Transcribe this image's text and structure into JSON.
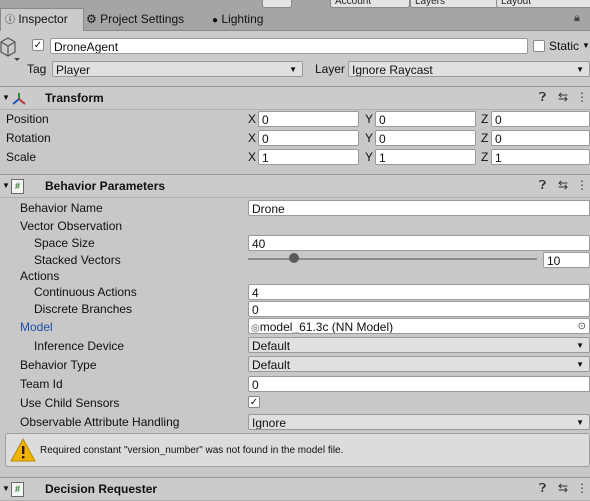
{
  "tabs": [
    {
      "label": "Inspector",
      "icon": "info-icon"
    },
    {
      "label": "Project Settings",
      "icon": "gear-icon"
    },
    {
      "label": "Lighting",
      "icon": "light-bulb-icon"
    }
  ],
  "toolbar": {
    "account": "Account",
    "layers": "Layers",
    "layout": "Layout"
  },
  "object": {
    "name": "DroneAgent",
    "active": true,
    "static_label": "Static",
    "static": false,
    "tag_label": "Tag",
    "tag_value": "Player",
    "layer_label": "Layer",
    "layer_value": "Ignore Raycast"
  },
  "transform": {
    "title": "Transform",
    "rows": [
      {
        "label": "Position",
        "x": "0",
        "y": "0",
        "z": "0"
      },
      {
        "label": "Rotation",
        "x": "0",
        "y": "0",
        "z": "0"
      },
      {
        "label": "Scale",
        "x": "1",
        "y": "1",
        "z": "1"
      }
    ],
    "axes": [
      "X",
      "Y",
      "Z"
    ]
  },
  "behavior": {
    "title": "Behavior Parameters",
    "behavior_name_label": "Behavior Name",
    "behavior_name": "Drone",
    "vector_obs_label": "Vector Observation",
    "space_size_label": "Space Size",
    "space_size": "40",
    "stacked_label": "Stacked Vectors",
    "stacked": "10",
    "stacked_slider_fraction": 0.16,
    "actions_label": "Actions",
    "continuous_label": "Continuous Actions",
    "continuous": "4",
    "discrete_label": "Discrete Branches",
    "discrete": "0",
    "model_label": "Model",
    "model": "model_61.3c (NN Model)",
    "inference_label": "Inference Device",
    "inference": "Default",
    "behavior_type_label": "Behavior Type",
    "behavior_type": "Default",
    "team_label": "Team Id",
    "team": "0",
    "child_sensors_label": "Use Child Sensors",
    "child_sensors": true,
    "observable_label": "Observable Attribute Handling",
    "observable": "Ignore",
    "warning": "Required constant \"version_number\" was not found in the model file."
  },
  "decision": {
    "title": "Decision Requester"
  },
  "colors": {
    "model_label": "#1a4fa8",
    "warning": "#f0b400"
  }
}
